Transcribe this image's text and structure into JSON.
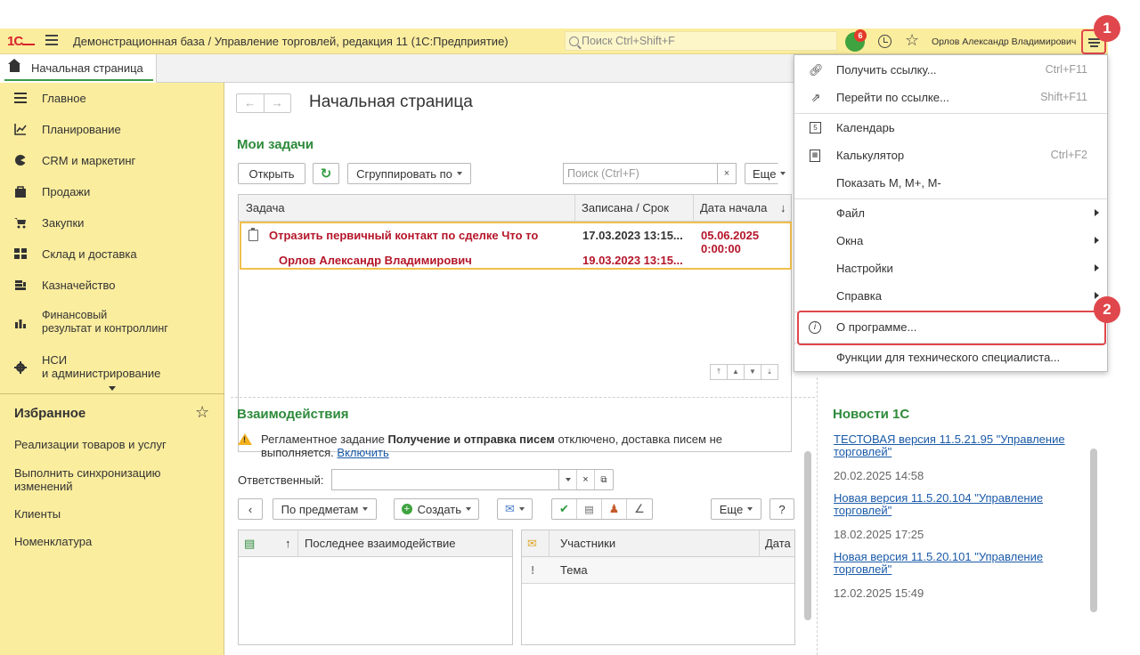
{
  "topbar": {
    "logo": "1С",
    "title": "Демонстрационная база / Управление торговлей, редакция 11  (1С:Предприятие)",
    "search_placeholder": "Поиск Ctrl+Shift+F",
    "notifications_count": "6",
    "user": "Орлов Александр Владимирович"
  },
  "tabs": {
    "home": "Начальная страница"
  },
  "sidebar": {
    "sections": [
      {
        "label": "Главное",
        "icon": "list-icon"
      },
      {
        "label": "Планирование",
        "icon": "planning-icon"
      },
      {
        "label": "CRM и маркетинг",
        "icon": "crm-icon"
      },
      {
        "label": "Продажи",
        "icon": "bag-icon"
      },
      {
        "label": "Закупки",
        "icon": "cart-icon"
      },
      {
        "label": "Склад и доставка",
        "icon": "warehouse-icon"
      },
      {
        "label": "Казначейство",
        "icon": "treasury-icon"
      },
      {
        "label": "Финансовый\nрезультат и контроллинг",
        "icon": "chart-icon"
      },
      {
        "label": "НСИ\nи администрирование",
        "icon": "gear-icon"
      }
    ],
    "favorites_title": "Избранное",
    "favorites": [
      "Реализации товаров и услуг",
      "Выполнить синхронизацию изменений",
      "Клиенты",
      "Номенклатура"
    ]
  },
  "main": {
    "page_title": "Начальная страница",
    "tasks": {
      "title": "Мои задачи",
      "open": "Открыть",
      "group_by": "Сгруппировать по",
      "search_placeholder": "Поиск (Ctrl+F)",
      "more": "Еще",
      "columns": [
        "Задача",
        "Записана / Срок",
        "Дата начала"
      ],
      "row": {
        "task": "Отразить первичный контакт по сделке Что то",
        "author": "Орлов Александр Владимирович",
        "recorded": "17.03.2023 13:15...",
        "due": "19.03.2023 13:15...",
        "start": "05.06.2025\n0:00:00"
      }
    },
    "interactions": {
      "title": "Взаимодействия",
      "warning_pre": "Регламентное задание ",
      "warning_bold": "Получение и отправка писем",
      "warning_post": " отключено, доставка писем не выполняется. ",
      "warning_link": "Включить",
      "responsible_label": "Ответственный:",
      "by_subject": "По предметам",
      "create": "Создать",
      "more": "Еще",
      "help": "?",
      "left_columns": [
        "Последнее взаимодействие"
      ],
      "right_columns": [
        "Участники",
        "Дата",
        "Тема"
      ]
    },
    "news": {
      "title": "Новости 1С",
      "items": [
        {
          "link": "ТЕСТОВАЯ версия 11.5.21.95 \"Управление торговлей\"",
          "date": "20.02.2025 14:58"
        },
        {
          "link": "Новая версия 11.5.20.104 \"Управление торговлей\"",
          "date": "18.02.2025 17:25"
        },
        {
          "link": "Новая версия 11.5.20.101 \"Управление торговлей\"",
          "date": "12.02.2025 15:49"
        }
      ]
    }
  },
  "menu": {
    "items": [
      {
        "label": "Получить ссылку...",
        "shortcut": "Ctrl+F11"
      },
      {
        "label": "Перейти по ссылке...",
        "shortcut": "Shift+F11"
      },
      {
        "label": "Календарь",
        "shortcut": ""
      },
      {
        "label": "Калькулятор",
        "shortcut": "Ctrl+F2"
      },
      {
        "label": "Показать M, M+, M-",
        "shortcut": ""
      },
      {
        "label": "Файл",
        "shortcut": ""
      },
      {
        "label": "Окна",
        "shortcut": ""
      },
      {
        "label": "Настройки",
        "shortcut": ""
      },
      {
        "label": "Справка",
        "shortcut": ""
      },
      {
        "label": "О программе...",
        "shortcut": ""
      },
      {
        "label": "Функции для технического специалиста...",
        "shortcut": ""
      }
    ]
  },
  "annotations": {
    "badge1": "1",
    "badge2": "2"
  },
  "colors": {
    "accent_yellow": "#fbed9e",
    "green": "#2d8a3a",
    "red": "#b5162a",
    "highlight": "#e0474c",
    "link": "#1a5aa8"
  }
}
